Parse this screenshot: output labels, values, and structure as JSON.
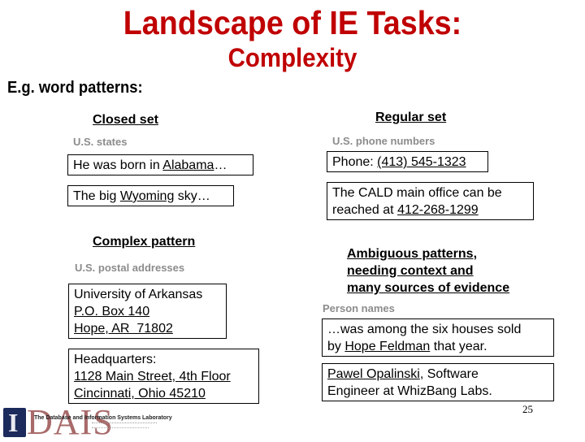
{
  "title": {
    "line1": "Landscape of IE Tasks:",
    "line2": "Complexity"
  },
  "subtitle": "E.g. word patterns:",
  "closed_set": {
    "heading": "Closed set",
    "hint": "U.S. states",
    "examples": [
      {
        "pre": "He was born in ",
        "match": "Alabama",
        "post": "…"
      },
      {
        "pre": "The big ",
        "match": "Wyoming",
        "post": " sky…"
      }
    ]
  },
  "regular_set": {
    "heading": "Regular set",
    "hint": "U.S. phone numbers",
    "examples": [
      {
        "pre": "Phone: ",
        "match": "(413) 545-1323",
        "post": ""
      },
      {
        "line1": "The CALD main office can be",
        "pre": "reached at ",
        "match": "412-268-1299",
        "post": ""
      }
    ]
  },
  "complex_pattern": {
    "heading": "Complex pattern",
    "hint": "U.S. postal addresses",
    "examples": [
      {
        "line1": "University of Arkansas",
        "line2": "P.O. Box 140",
        "line3": "Hope, AR  71802"
      },
      {
        "line1": "Headquarters:",
        "line2": "1128 Main Street, 4th Floor",
        "line3": "Cincinnati, Ohio 45210"
      }
    ]
  },
  "ambiguous": {
    "heading_lines": [
      "Ambiguous patterns,",
      "needing context and",
      "many sources of evidence"
    ],
    "hint": "Person names",
    "examples": [
      {
        "line1": "…was among the six houses sold",
        "pre": "by ",
        "match": "Hope Feldman",
        "post": " that year."
      },
      {
        "match": "Pawel Opalinski",
        "post": ", Software",
        "line2": "Engineer at WhizBang Labs."
      }
    ]
  },
  "page_number": "25",
  "logo": {
    "letter": "I",
    "name": "DAIS",
    "lab": "The Database and Information Systems Laboratory"
  }
}
